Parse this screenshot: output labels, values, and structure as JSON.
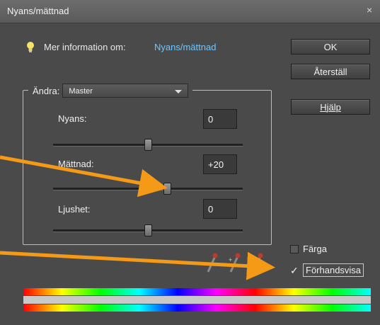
{
  "window": {
    "title": "Nyans/mättnad",
    "close_glyph": "×"
  },
  "info": {
    "label": "Mer information om:",
    "link": "Nyans/mättnad"
  },
  "buttons": {
    "ok": "OK",
    "reset": "Återställ",
    "help": "Hjälp"
  },
  "edit": {
    "label": "Ändra:",
    "selected": "Master"
  },
  "sliders": [
    {
      "label": "Nyans:",
      "value": "0",
      "fraction": 0.5
    },
    {
      "label": "Mättnad:",
      "value": "+20",
      "fraction": 0.6
    },
    {
      "label": "Ljushet:",
      "value": "0",
      "fraction": 0.5
    }
  ],
  "checkboxes": {
    "colorize": "Färga",
    "colorize_checked": false,
    "preview": "Förhandsvisa",
    "preview_checked": true
  },
  "colors": {
    "accent_arrow": "#f59a17",
    "link": "#6ec6ff",
    "eyedropper": "#c0392b"
  }
}
